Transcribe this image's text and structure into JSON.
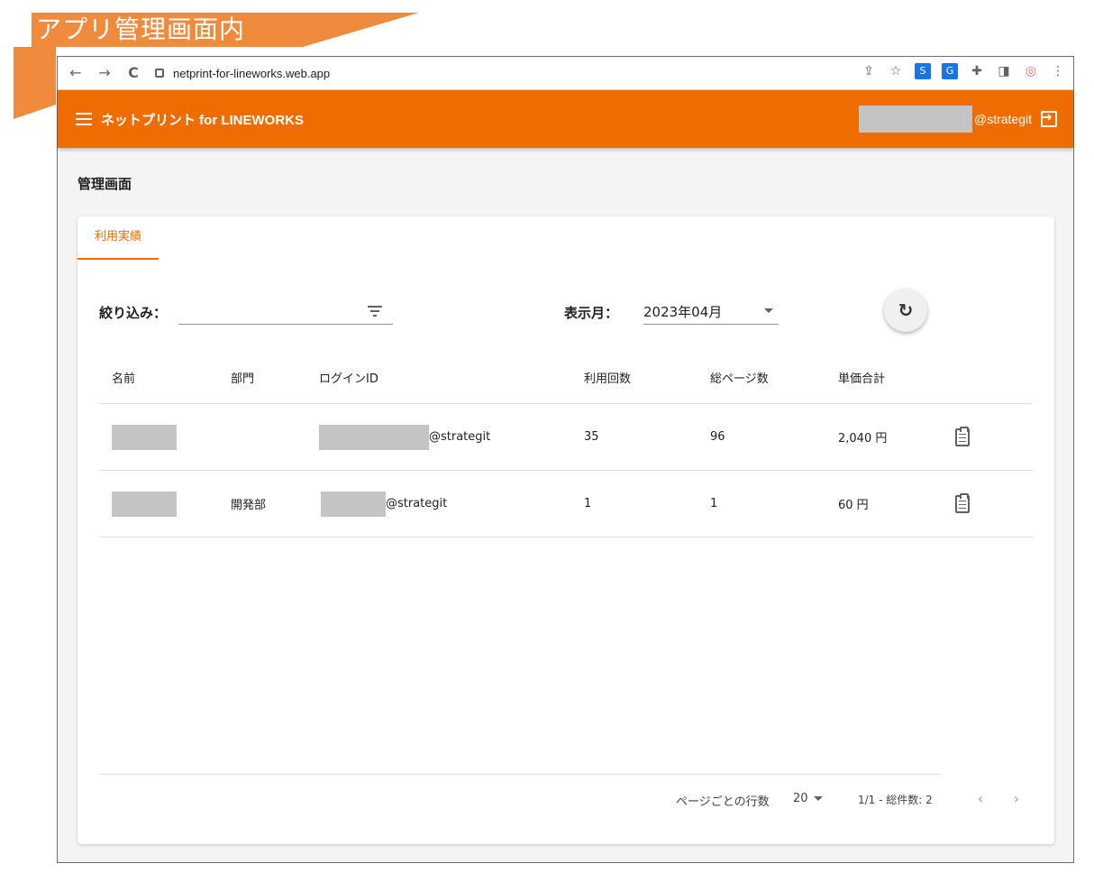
{
  "banner": {
    "text": "アプリ管理画面内"
  },
  "browser": {
    "url": "netprint-for-lineworks.web.app",
    "nav": {
      "back": "←",
      "forward": "→",
      "reload": "C"
    }
  },
  "header": {
    "title": "ネットプリント for LINEWORKS",
    "user_domain": "@strategit"
  },
  "page": {
    "title": "管理画面"
  },
  "tabs": [
    {
      "label": "利用実績"
    }
  ],
  "filter": {
    "label": "絞り込み：",
    "value": ""
  },
  "month": {
    "label": "表示月：",
    "value": "2023年04月"
  },
  "table": {
    "headers": {
      "name": "名前",
      "dept": "部門",
      "login": "ログインID",
      "count": "利用回数",
      "pages": "総ページ数",
      "price": "単価合計"
    },
    "rows": [
      {
        "dept": "",
        "login_domain": "@strategit",
        "count": "35",
        "pages": "96",
        "price": "2,040 円"
      },
      {
        "dept": "開発部",
        "login_domain": "@strategit",
        "count": "1",
        "pages": "1",
        "price": "60 円"
      }
    ]
  },
  "pagination": {
    "rows_label": "ページごとの行数",
    "rows_per_page": "20",
    "range": "1/1 - 総件数: 2",
    "prev": "‹",
    "next": "›"
  },
  "colors": {
    "accent": "#ef6c00",
    "banner": "#f08a3c",
    "redaction": "#c4c4c4"
  }
}
